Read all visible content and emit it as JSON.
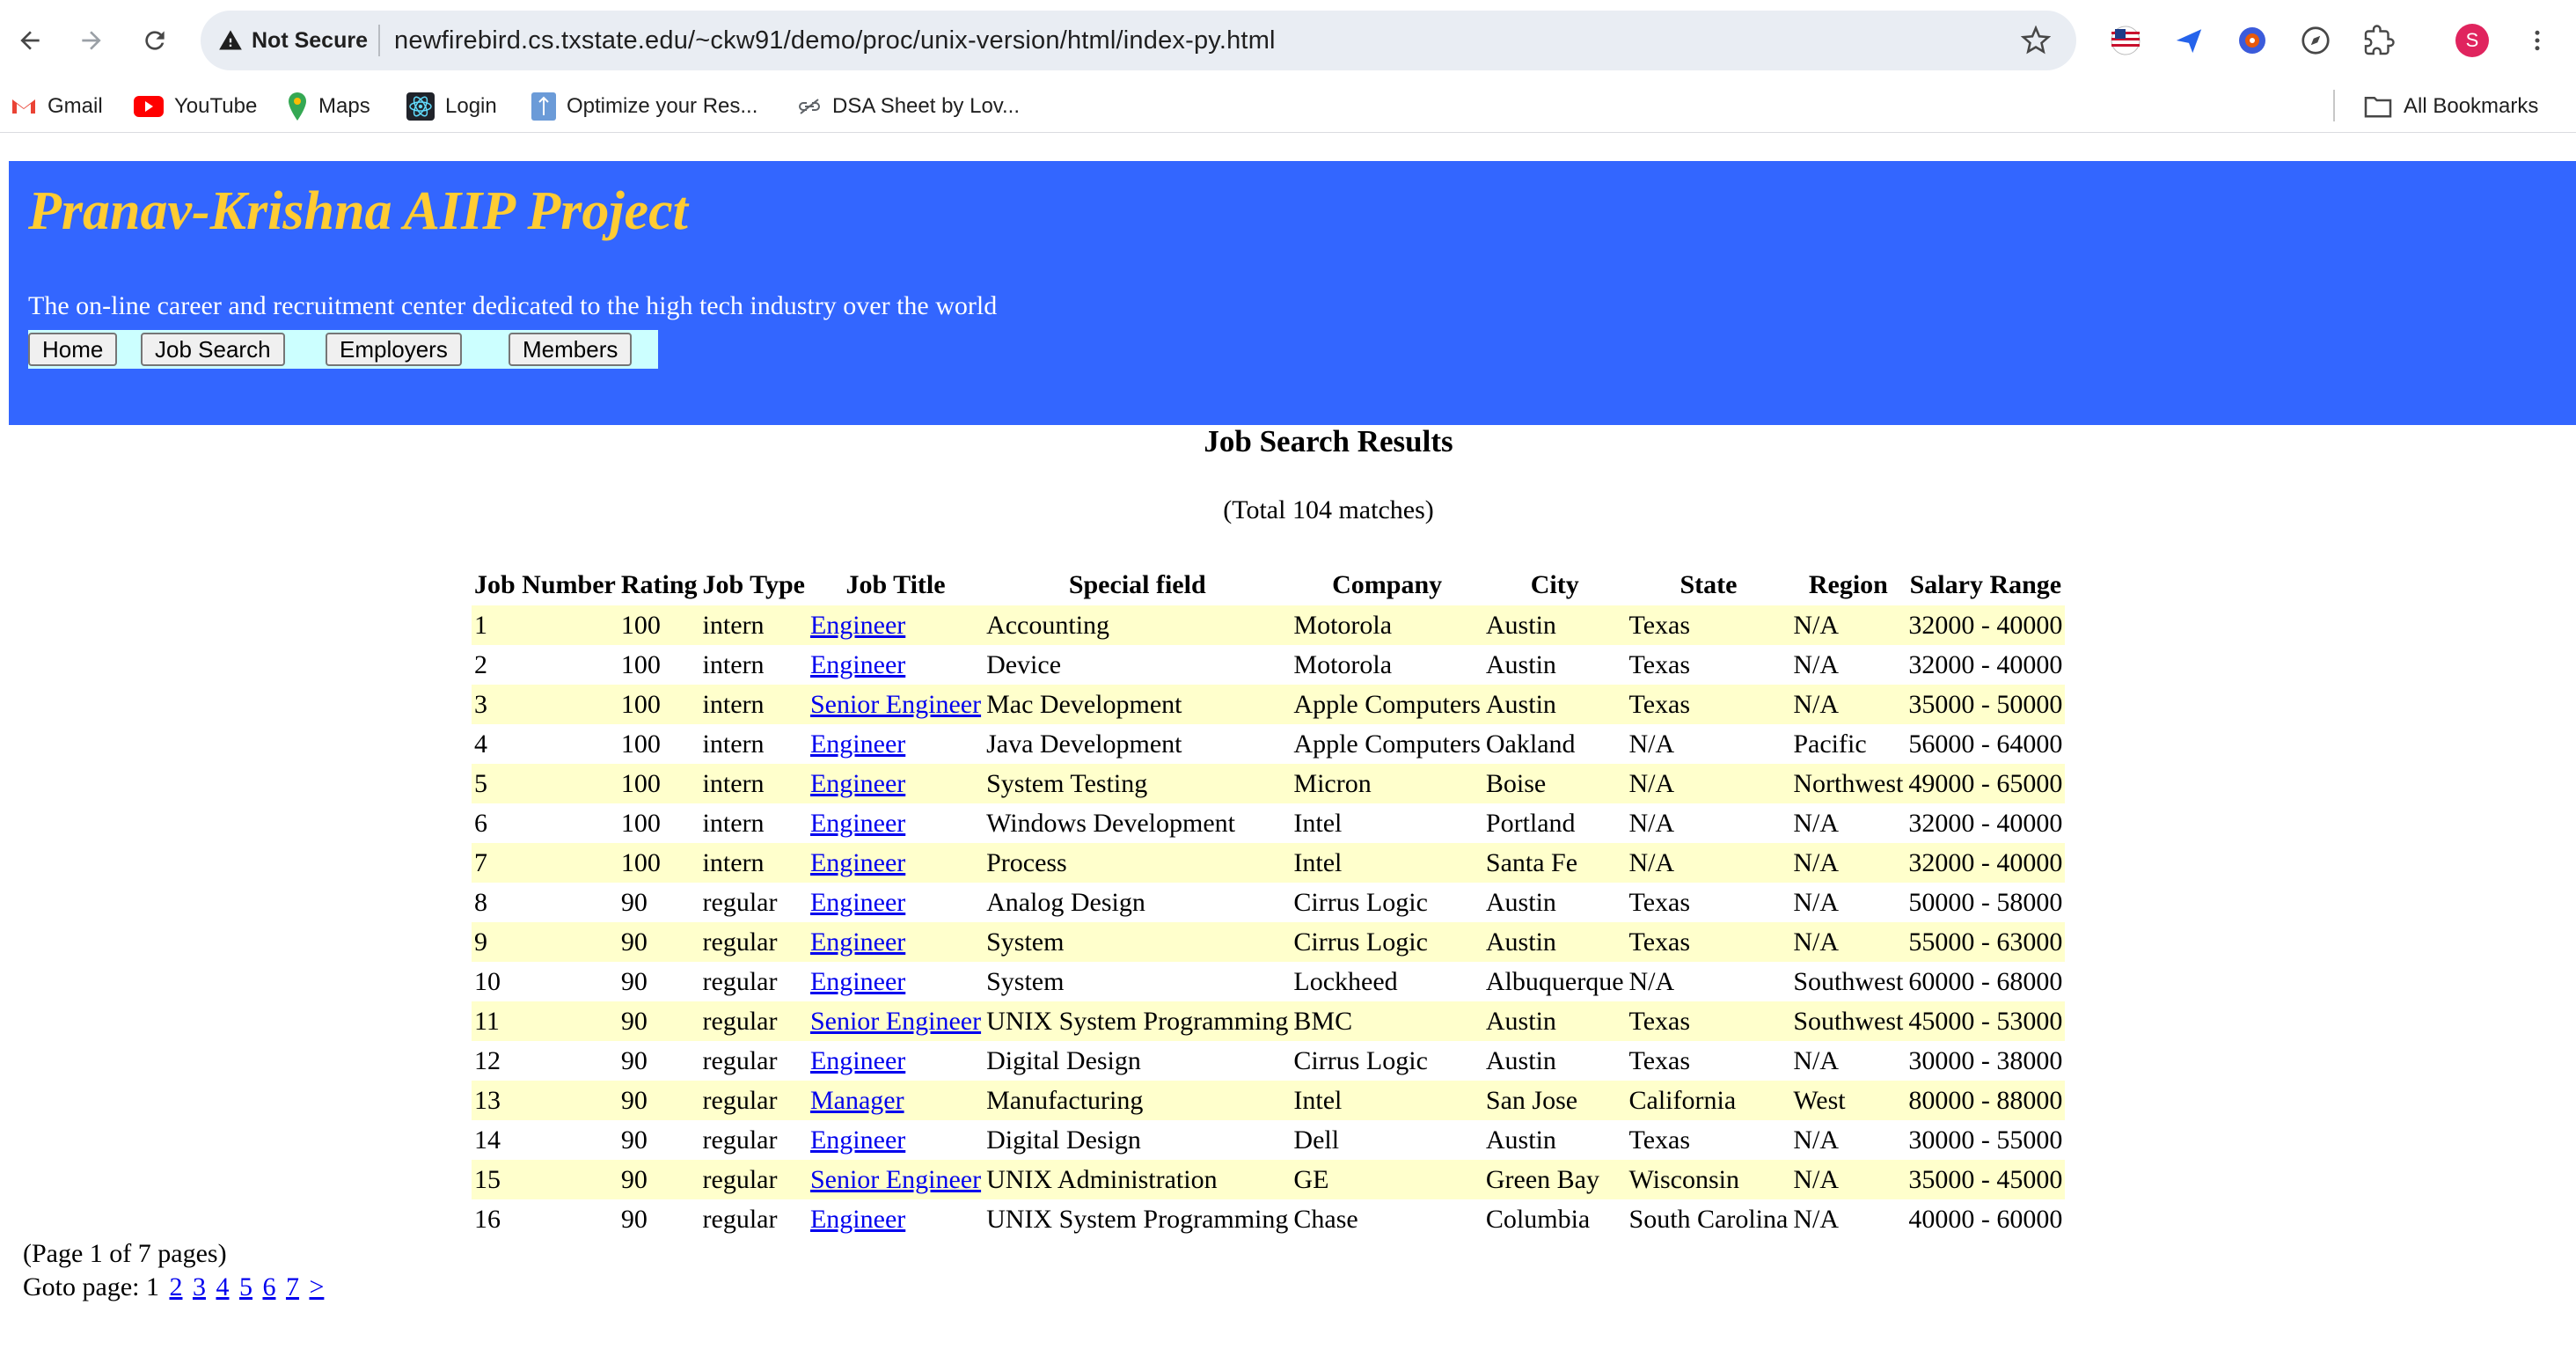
{
  "browser": {
    "security_label": "Not Secure",
    "url": "newfirebird.cs.txstate.edu/~ckw91/demo/proc/unix-version/html/index-py.html",
    "profile_initial": "S",
    "bookmarks": [
      {
        "label": "Gmail",
        "icon": "gmail-icon"
      },
      {
        "label": "YouTube",
        "icon": "youtube-icon"
      },
      {
        "label": "Maps",
        "icon": "maps-icon"
      },
      {
        "label": "Login",
        "icon": "react-icon"
      },
      {
        "label": "Optimize your Res...",
        "icon": "doc-icon"
      },
      {
        "label": "DSA Sheet by Lov...",
        "icon": "link-icon"
      }
    ],
    "all_bookmarks_label": "All Bookmarks"
  },
  "header": {
    "title": "Pranav-Krishna AIIP Project",
    "tagline": "The on-line career and recruitment center dedicated to the high tech industry over the world",
    "nav": {
      "home": "Home",
      "job_search": "Job Search",
      "employers": "Employers",
      "members": "Members"
    }
  },
  "results": {
    "title": "Job Search Results",
    "total": "(Total 104 matches)",
    "columns": [
      "Job Number",
      "Rating",
      "Job Type",
      "Job Title",
      "Special field",
      "Company",
      "City",
      "State",
      "Region",
      "Salary Range"
    ],
    "rows": [
      [
        "1",
        "100",
        "intern",
        "Engineer",
        "Accounting",
        "Motorola",
        "Austin",
        "Texas",
        "N/A",
        "32000 - 40000"
      ],
      [
        "2",
        "100",
        "intern",
        "Engineer",
        "Device",
        "Motorola",
        "Austin",
        "Texas",
        "N/A",
        "32000 - 40000"
      ],
      [
        "3",
        "100",
        "intern",
        "Senior Engineer",
        "Mac Development",
        "Apple Computers",
        "Austin",
        "Texas",
        "N/A",
        "35000 - 50000"
      ],
      [
        "4",
        "100",
        "intern",
        "Engineer",
        "Java Development",
        "Apple Computers",
        "Oakland",
        "N/A",
        "Pacific",
        "56000 - 64000"
      ],
      [
        "5",
        "100",
        "intern",
        "Engineer",
        "System Testing",
        "Micron",
        "Boise",
        "N/A",
        "Northwest",
        "49000 - 65000"
      ],
      [
        "6",
        "100",
        "intern",
        "Engineer",
        "Windows Development",
        "Intel",
        "Portland",
        "N/A",
        "N/A",
        "32000 - 40000"
      ],
      [
        "7",
        "100",
        "intern",
        "Engineer",
        "Process",
        "Intel",
        "Santa Fe",
        "N/A",
        "N/A",
        "32000 - 40000"
      ],
      [
        "8",
        "90",
        "regular",
        "Engineer",
        "Analog Design",
        "Cirrus Logic",
        "Austin",
        "Texas",
        "N/A",
        "50000 - 58000"
      ],
      [
        "9",
        "90",
        "regular",
        "Engineer",
        "System",
        "Cirrus Logic",
        "Austin",
        "Texas",
        "N/A",
        "55000 - 63000"
      ],
      [
        "10",
        "90",
        "regular",
        "Engineer",
        "System",
        "Lockheed",
        "Albuquerque",
        "N/A",
        "Southwest",
        "60000 - 68000"
      ],
      [
        "11",
        "90",
        "regular",
        "Senior Engineer",
        "UNIX System Programming",
        "BMC",
        "Austin",
        "Texas",
        "Southwest",
        "45000 - 53000"
      ],
      [
        "12",
        "90",
        "regular",
        "Engineer",
        "Digital Design",
        "Cirrus Logic",
        "Austin",
        "Texas",
        "N/A",
        "30000 - 38000"
      ],
      [
        "13",
        "90",
        "regular",
        "Manager",
        "Manufacturing",
        "Intel",
        "San Jose",
        "California",
        "West",
        "80000 - 88000"
      ],
      [
        "14",
        "90",
        "regular",
        "Engineer",
        "Digital Design",
        "Dell",
        "Austin",
        "Texas",
        "N/A",
        "30000 - 55000"
      ],
      [
        "15",
        "90",
        "regular",
        "Senior Engineer",
        "UNIX Administration",
        "GE",
        "Green Bay",
        "Wisconsin",
        "N/A",
        "35000 - 45000"
      ],
      [
        "16",
        "90",
        "regular",
        "Engineer",
        "UNIX System Programming",
        "Chase",
        "Columbia",
        "South Carolina",
        "N/A",
        "40000 - 60000"
      ]
    ]
  },
  "pagination": {
    "page_info": "(Page 1 of 7 pages)",
    "goto_label": "Goto page:",
    "current": "1",
    "pages": [
      "2",
      "3",
      "4",
      "5",
      "6",
      "7"
    ],
    "next": ">"
  },
  "colors": {
    "banner": "#3366ff",
    "title": "#ffcc33",
    "nav_bg": "#ccffff",
    "row_highlight": "#ffffcc",
    "link": "#0000ee"
  }
}
